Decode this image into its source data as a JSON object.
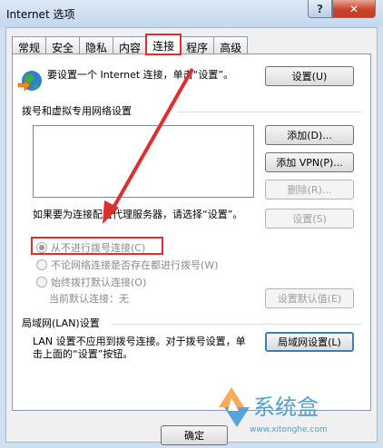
{
  "window": {
    "title": "Internet 选项",
    "help_icon": "?",
    "close_icon": "✕"
  },
  "tabs": [
    {
      "label": "常规"
    },
    {
      "label": "安全"
    },
    {
      "label": "隐私"
    },
    {
      "label": "内容"
    },
    {
      "label": "连接",
      "active": true
    },
    {
      "label": "程序"
    },
    {
      "label": "高级"
    }
  ],
  "setup": {
    "text": "要设置一个 Internet 连接，单击“设置”。",
    "button": "设置(U)"
  },
  "dialup": {
    "heading": "拨号和虚拟专用网络设置",
    "add": "添加(D)...",
    "add_vpn": "添加 VPN(P)...",
    "remove": "删除(R)...",
    "settings": "设置(S)",
    "proxy_hint": "如果要为连接配置代理服务器，请选择“设置”。",
    "options": [
      {
        "label": "从不进行拨号连接(C)",
        "checked": true
      },
      {
        "label": "不论网络连接是否存在都进行拨号(W)",
        "checked": false
      },
      {
        "label": "始终拨打默认连接(O)",
        "checked": false
      }
    ],
    "current_default": "当前默认连接：",
    "current_default_value": "无",
    "set_default": "设置默认值(E)"
  },
  "lan": {
    "heading": "局域网(LAN)设置",
    "text": "LAN 设置不应用到拨号连接。对于拨号设置，单击上面的“设置”按钮。",
    "button": "局域网设置(L)"
  },
  "footer": {
    "ok": "确定"
  },
  "watermark": {
    "brand": "系统盒",
    "url": "www.xitonghe.com"
  },
  "colors": {
    "highlight": "#e02d2d",
    "arrow": "#e02d2d"
  }
}
